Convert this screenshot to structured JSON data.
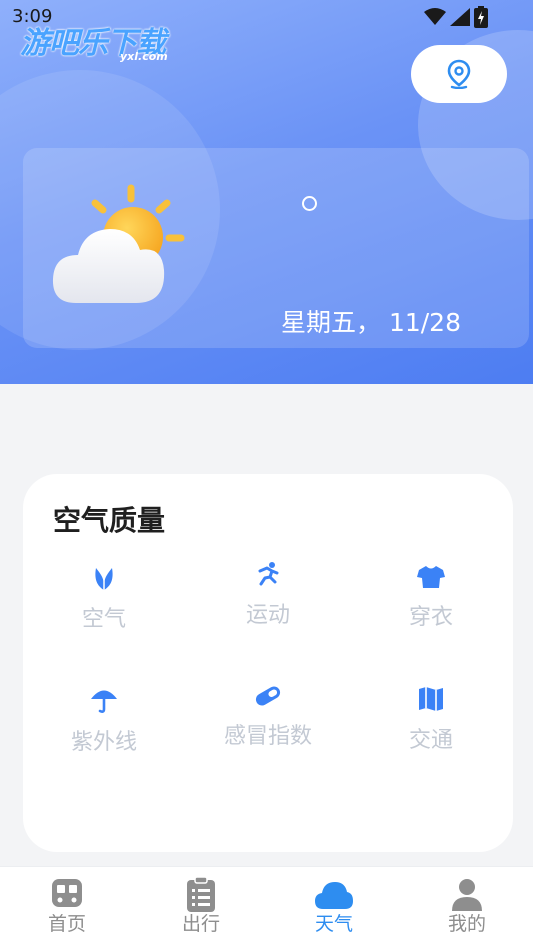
{
  "status_bar": {
    "time": "3:09"
  },
  "watermark": {
    "text": "游吧乐下载",
    "sub": "yxl.com"
  },
  "weather": {
    "date": "星期五， 11/28"
  },
  "air_quality": {
    "title": "空气质量",
    "items": [
      {
        "label": "空气",
        "icon": "leaf-icon"
      },
      {
        "label": "运动",
        "icon": "running-icon"
      },
      {
        "label": "穿衣",
        "icon": "shirt-icon"
      },
      {
        "label": "紫外线",
        "icon": "umbrella-icon"
      },
      {
        "label": "感冒指数",
        "icon": "pill-icon"
      },
      {
        "label": "交通",
        "icon": "map-icon"
      }
    ]
  },
  "tabs": [
    {
      "label": "首页",
      "icon": "train-icon"
    },
    {
      "label": "出行",
      "icon": "clipboard-icon"
    },
    {
      "label": "天气",
      "icon": "cloud-icon"
    },
    {
      "label": "我的",
      "icon": "person-icon"
    }
  ],
  "colors": {
    "accent": "#2e8df0",
    "icon_blue": "#3b82f6",
    "label_gray": "#c3c9d3"
  }
}
